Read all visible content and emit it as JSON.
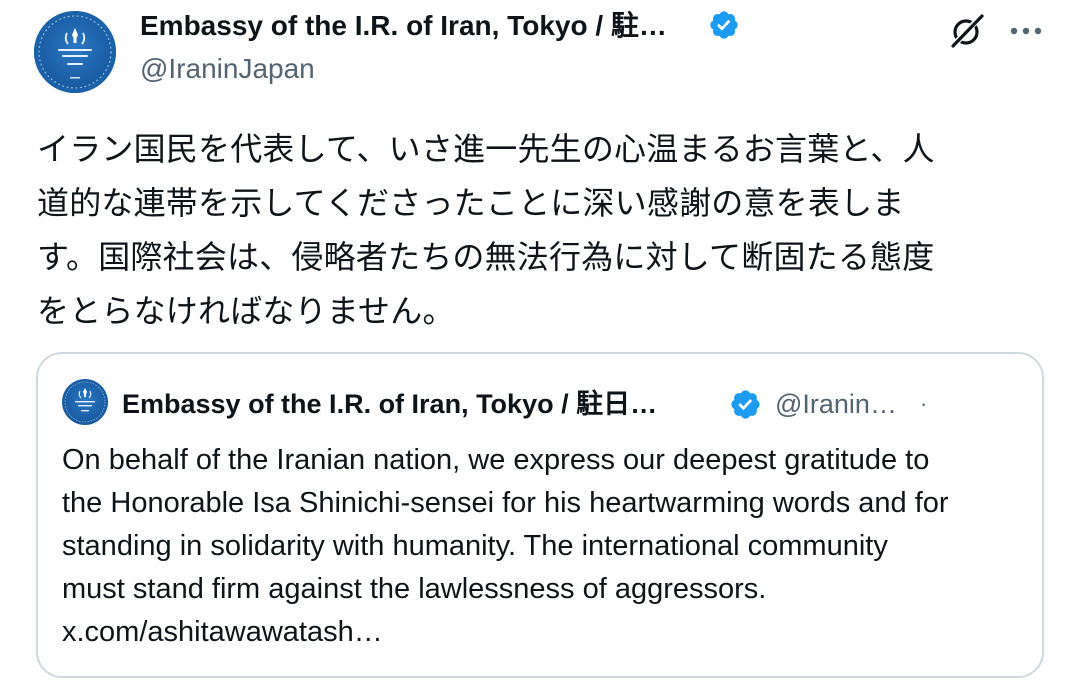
{
  "tweet": {
    "author": {
      "name": "Embassy of the I.R. of Iran, Tokyo / 駐…",
      "handle": "@IraninJapan",
      "verified": true,
      "avatar": "embassy-emblem-avatar"
    },
    "text_lines": [
      "イラン国民を代表して、いさ進一先生の心温まるお言葉と、人",
      "道的な連帯を示してくださったことに深い感謝の意を表しま",
      "す。国際社会は、侵略者たちの無法行為に対して断固たる態度",
      "をとらなければなりません。"
    ]
  },
  "toolbar": {
    "grok_icon": "grok-icon",
    "more_icon": "more-dots-icon"
  },
  "quote": {
    "author": {
      "name": "Embassy of the I.R. of Iran, Tokyo / 駐日…",
      "handle": "@Iranin…",
      "verified": true,
      "separator": "·"
    },
    "text_lines": [
      "On behalf of the Iranian nation, we express our deepest gratitude to",
      "the Honorable Isa Shinichi-sensei for his heartwarming words and for",
      "standing in solidarity with humanity. The international community",
      "must stand firm against the lawlessness of aggressors.",
      "x.com/ashitawawatash…"
    ]
  },
  "colors": {
    "text": "#0f1419",
    "secondary": "#536471",
    "verified_blue": "#1d9bf0",
    "border": "#cfd9de",
    "avatar_blue": "#1b5fa6"
  }
}
